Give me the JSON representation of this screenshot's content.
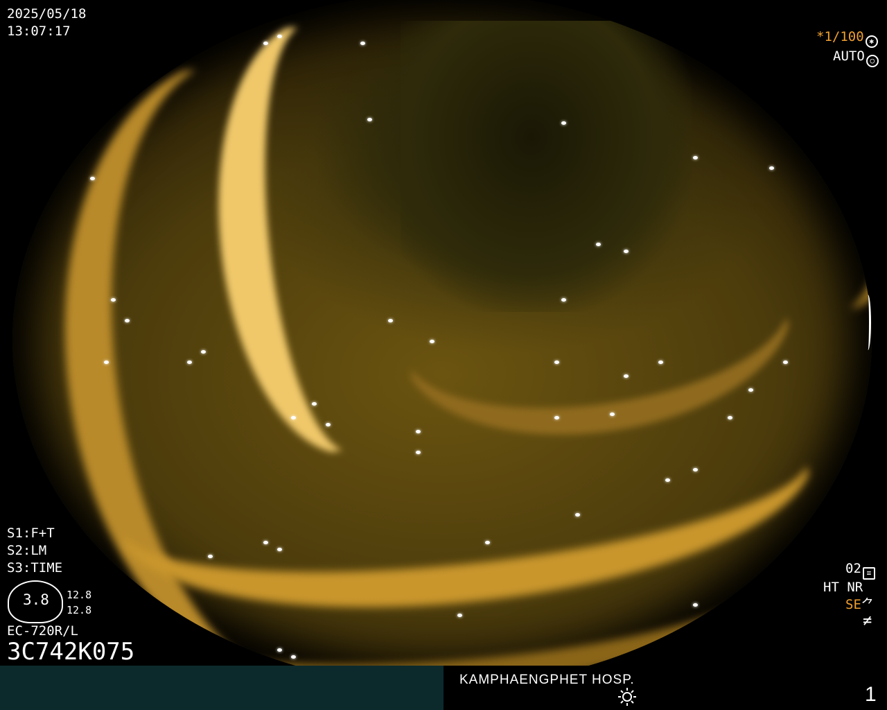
{
  "overlay": {
    "date": "2025/05/18",
    "time": "13:07:17",
    "shutter": "*1/100",
    "exposure": "AUTO",
    "s1": "S1:F+T",
    "s2": "S2:LM",
    "s3": "S3:TIME",
    "gauge_value": "3.8",
    "gauge_top": "12.8",
    "gauge_bottom": "12.8",
    "scope_model": "EC-720R/L",
    "serial": "3C742K075",
    "mode_02": "02",
    "ht_nr": "HT NR",
    "se": "SE",
    "hospital": "KAMPHAENGPHET HOSP.",
    "page": "1"
  },
  "colors": {
    "accent_orange": "#f0a030",
    "bottom_bar": "#0c2a2c"
  },
  "icons": [
    "aperture-icon",
    "camera-icon",
    "settings-icon",
    "filter-icon",
    "brightness-icon"
  ]
}
